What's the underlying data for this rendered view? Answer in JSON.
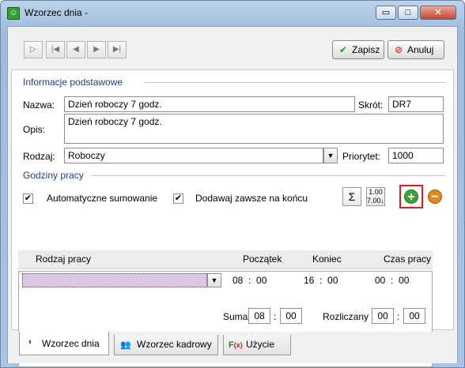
{
  "window": {
    "title": "Wzorzec dnia -",
    "app_icon": "app-icon"
  },
  "titlebar_buttons": {
    "minimize": "▭",
    "maximize": "□",
    "close": "✕"
  },
  "nav": {
    "first": "▷",
    "prev_first": "|◀",
    "prev": "◀",
    "next": "▶",
    "last": "▶|"
  },
  "actions": {
    "save_label": "Zapisz",
    "cancel_label": "Anuluj"
  },
  "basic_info": {
    "section_label": "Informacje podstawowe",
    "name_label": "Nazwa:",
    "name_value": "Dzień roboczy 7 godz.",
    "short_label": "Skrót:",
    "short_value": "DR7",
    "desc_label": "Opis:",
    "desc_value": "Dzień roboczy 7 godz.",
    "type_label": "Rodzaj:",
    "type_value": "Roboczy",
    "priority_label": "Priorytet:",
    "priority_value": "1000"
  },
  "work_hours": {
    "section_label": "Godziny pracy",
    "auto_sum_label": "Automatyczne sumowanie",
    "auto_sum_checked": true,
    "append_end_label": "Dodawaj zawsze na końcu",
    "append_end_checked": true,
    "columns": [
      "Rodzaj pracy",
      "Początek",
      "Koniec",
      "Czas pracy"
    ],
    "row": {
      "work_type": "",
      "start_h": "08",
      "start_m": "00",
      "end_h": "16",
      "end_m": "00",
      "dur_h": "00",
      "dur_m": "00"
    },
    "sum_label": "Suma",
    "sum_h": "08",
    "sum_m": "00",
    "settled_label": "Rozliczany",
    "settled_h": "00",
    "settled_m": "00"
  },
  "tabs": [
    {
      "label": "Wzorzec dnia",
      "icon": "day-pattern-icon"
    },
    {
      "label": "Wzorzec kadrowy",
      "icon": "people-icon"
    },
    {
      "label": "Użycie",
      "icon": "function-icon"
    }
  ],
  "colors": {
    "section": "#1f3f86",
    "add": "#3aa53a",
    "remove": "#e08a1e",
    "highlight": "#d42020",
    "row_fill": "#d9c7e4"
  }
}
